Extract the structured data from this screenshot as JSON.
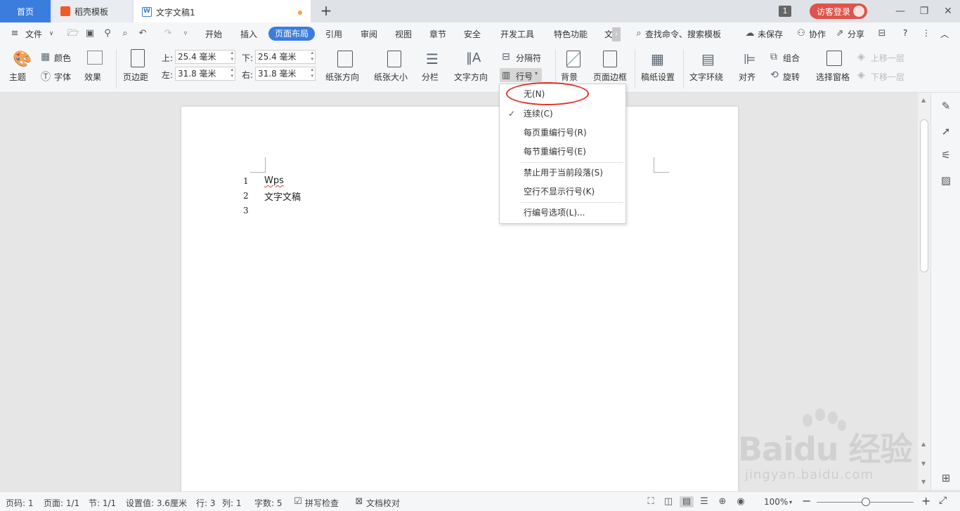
{
  "tabs": {
    "home": "首页",
    "template": "稻壳模板",
    "document": "文字文稿1",
    "add": "+"
  },
  "titlebar": {
    "badge": "1",
    "login": "访客登录",
    "minimize": "—",
    "restore": "❐",
    "close": "✕"
  },
  "menubar": {
    "file": "文件",
    "items": [
      "开始",
      "插入",
      "页面布局",
      "引用",
      "审阅",
      "视图",
      "章节",
      "安全",
      "开发工具",
      "特色功能",
      "文"
    ],
    "active_index": 2,
    "search": "查找命令、搜索模板",
    "unsaved": "未保存",
    "collab": "协作",
    "share": "分享",
    "help": "?",
    "more": "⋮",
    "collapse": "︿"
  },
  "ribbon": {
    "theme": "主题",
    "color": "颜色",
    "font": "字体",
    "effect": "效果",
    "margin": "页边距",
    "top_label": "上:",
    "top_value": "25.4 毫米",
    "bottom_label": "下:",
    "bottom_value": "25.4 毫米",
    "left_label": "左:",
    "left_value": "31.8 毫米",
    "right_label": "右:",
    "right_value": "31.8 毫米",
    "orientation": "纸张方向",
    "size": "纸张大小",
    "columns": "分栏",
    "text_direction": "文字方向",
    "separator": "分隔符",
    "line_number": "行号",
    "background": "背景",
    "page_border": "页面边框",
    "manuscript": "稿纸设置",
    "wrap": "文字环绕",
    "align": "对齐",
    "group": "组合",
    "rotate": "旋转",
    "selection_pane": "选择窗格",
    "bring_forward": "上移一层",
    "send_backward": "下移一层"
  },
  "document": {
    "lines": [
      {
        "num": "1",
        "text": "Wps"
      },
      {
        "num": "2",
        "text": "文字文稿"
      },
      {
        "num": "3",
        "text": ""
      }
    ]
  },
  "dropdown": {
    "items": [
      {
        "label": "无(N)",
        "checked": false
      },
      {
        "label": "连续(C)",
        "checked": true
      },
      {
        "label": "每页重编行号(R)",
        "checked": false
      },
      {
        "label": "每节重编行号(E)",
        "checked": false
      },
      {
        "label": "禁止用于当前段落(S)",
        "checked": false
      },
      {
        "label": "空行不显示行号(K)",
        "checked": false
      },
      {
        "label": "行编号选项(L)...",
        "checked": false
      }
    ]
  },
  "statusbar": {
    "page_code": "页码: 1",
    "page": "页面: 1/1",
    "section": "节: 1/1",
    "setting": "设置值: 3.6厘米",
    "row": "行: 3",
    "col": "列: 1",
    "words": "字数: 5",
    "spell": "拼写检查",
    "proof": "文档校对",
    "zoom": "100%"
  },
  "watermark": {
    "brand": "Baidu 经验",
    "url": "jingyan.baidu.com"
  }
}
